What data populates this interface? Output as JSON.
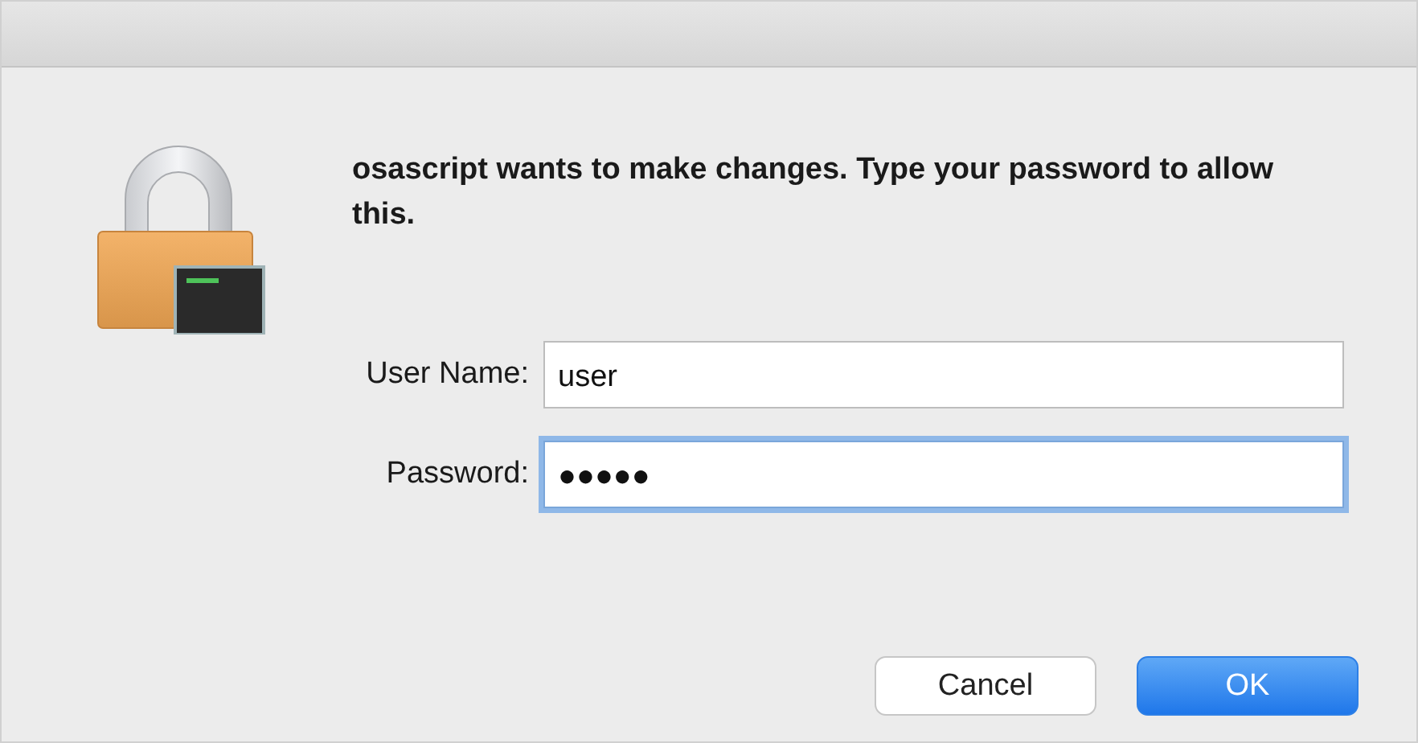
{
  "message": "osascript wants to make changes. Type your password to allow this.",
  "fields": [
    {
      "label": "User Name:",
      "value": "user",
      "focused": false
    },
    {
      "label": "Password:",
      "value": "●●●●●",
      "focused": true
    }
  ],
  "buttons": [
    {
      "label": "Cancel",
      "default": false
    },
    {
      "label": "OK",
      "default": true
    }
  ]
}
